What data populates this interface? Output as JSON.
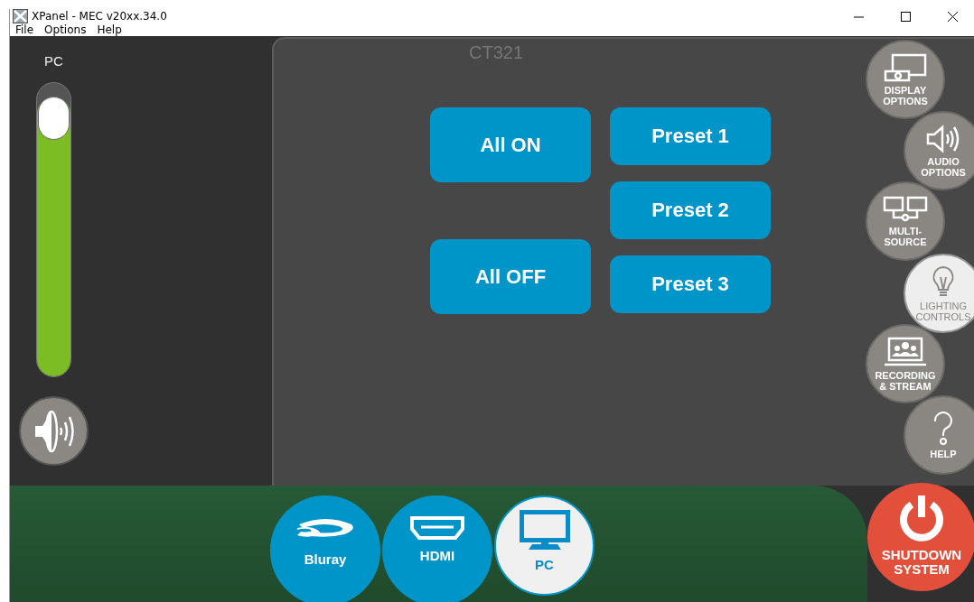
{
  "window": {
    "title": "XPanel - MEC v20xx.34.0"
  },
  "menu": [
    "File",
    "Options",
    "Help"
  ],
  "volume": {
    "label": "PC",
    "level": 0.95
  },
  "panel_label": "CT321",
  "actions": [
    {
      "label": "All ON"
    },
    {
      "label": "All OFF"
    }
  ],
  "presets": [
    {
      "label": "Preset 1"
    },
    {
      "label": "Preset 2"
    },
    {
      "label": "Preset 3"
    }
  ],
  "side_buttons": [
    {
      "kind": "display",
      "lines": [
        "DISPLAY",
        "OPTIONS"
      ],
      "selected": false
    },
    {
      "kind": "audio",
      "lines": [
        "AUDIO",
        "OPTIONS"
      ],
      "selected": false
    },
    {
      "kind": "multi",
      "lines": [
        "MULTI-",
        "SOURCE"
      ],
      "selected": false
    },
    {
      "kind": "lighting",
      "lines": [
        "LIGHTING",
        "CONTROLS"
      ],
      "selected": true
    },
    {
      "kind": "recording",
      "lines": [
        "RECORDING",
        "& STREAM"
      ],
      "selected": false
    },
    {
      "kind": "help",
      "lines": [
        "HELP"
      ],
      "selected": false
    }
  ],
  "shutdown": {
    "lines": [
      "SHUTDOWN",
      "SYSTEM"
    ]
  },
  "sources": [
    {
      "kind": "bluray",
      "label": "Bluray",
      "selected": false
    },
    {
      "kind": "hdmi",
      "label": "HDMI",
      "selected": false
    },
    {
      "kind": "pc",
      "label": "PC",
      "selected": true
    }
  ]
}
